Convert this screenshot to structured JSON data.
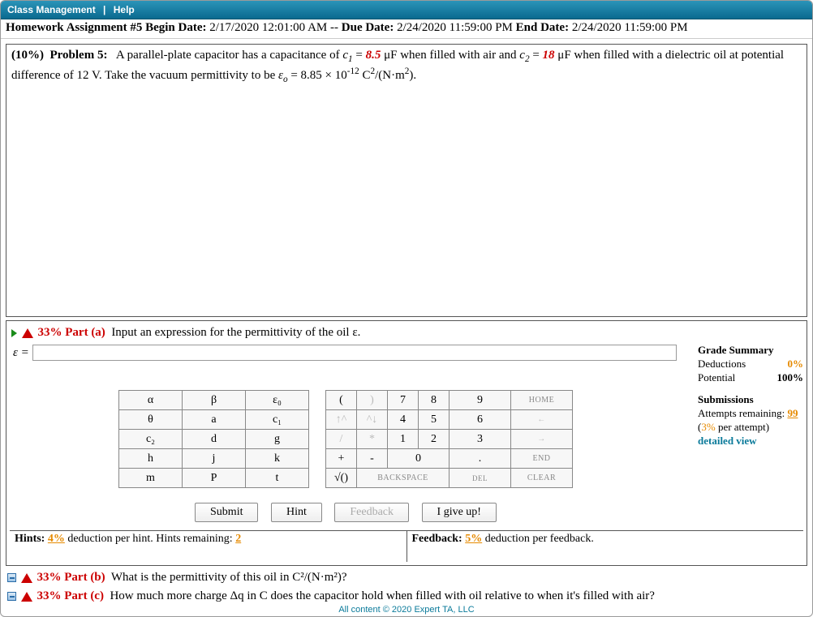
{
  "topbar": {
    "class_mgmt": "Class Management",
    "sep": "|",
    "help": "Help"
  },
  "assignment": {
    "title": "Homework Assignment #5",
    "begin_label": "Begin Date:",
    "begin": "2/17/2020 12:01:00 AM",
    "dash": "--",
    "due_label": "Due Date:",
    "due": "2/24/2020 11:59:00 PM",
    "end_label": "End Date:",
    "end": "2/24/2020 11:59:00 PM"
  },
  "problem": {
    "weight": "(10%)",
    "label": "Problem 5:",
    "t1": "A parallel-plate capacitor has a capacitance of ",
    "c1_sym": "c",
    "c1_sub": "1",
    "eq": " = ",
    "c1_val": "8.5",
    "c1_unit": " μF when filled with air and ",
    "c2_sym": "c",
    "c2_sub": "2",
    "c2_val": "18",
    "c2_unit": " μF when filled with a dielectric oil at potential difference of 12 V. Take the vacuum permittivity to be ",
    "eps": "ε",
    "eps_sub": "o",
    "eps_val": " = 8.85 × 10",
    "eps_exp": "-12",
    "eps_unit_a": " C",
    "eps_unit_b": "/(N·m",
    "eps_unit_c": ")."
  },
  "part_a": {
    "pct": "33%",
    "label": "Part (a)",
    "prompt": "Input an expression for the permittivity of the oil ε.",
    "lhs": "ε ="
  },
  "grade": {
    "hdr": "Grade Summary",
    "ded_label": "Deductions",
    "ded": "0%",
    "pot_label": "Potential",
    "pot": "100%",
    "sub_hdr": "Submissions",
    "att_label": "Attempts remaining:",
    "att": "99",
    "per": "(3% per attempt)",
    "detail": "detailed view"
  },
  "vars": [
    [
      "α",
      "β",
      "ε₀"
    ],
    [
      "θ",
      "a",
      "c₁"
    ],
    [
      "c₂",
      "d",
      "g"
    ],
    [
      "h",
      "j",
      "k"
    ],
    [
      "m",
      "P",
      "t"
    ]
  ],
  "nums": {
    "r1": [
      "(",
      ")",
      "7",
      "8",
      "9",
      "HOME"
    ],
    "r2": [
      "↑^",
      "^↓",
      "4",
      "5",
      "6",
      "←"
    ],
    "r3": [
      "/",
      "*",
      "1",
      "2",
      "3",
      "→"
    ],
    "r4": [
      "+",
      "-",
      "0",
      ".",
      "END"
    ],
    "r5": [
      "√()",
      "BACKSPACE",
      "DEL",
      "CLEAR"
    ]
  },
  "actions": {
    "submit": "Submit",
    "hint": "Hint",
    "feedback": "Feedback",
    "giveup": "I give up!"
  },
  "hints": {
    "h_label": "Hints:",
    "h_pct": "4%",
    "h_txt1": " deduction per hint. Hints remaining: ",
    "h_rem": "2",
    "f_label": "Feedback:",
    "f_pct": "5%",
    "f_txt": " deduction per feedback."
  },
  "part_b": {
    "pct": "33%",
    "label": "Part (b)",
    "txt": "What is the permittivity of this oil in C²/(N·m²)?"
  },
  "part_c": {
    "pct": "33%",
    "label": "Part (c)",
    "txt": "How much more charge Δq in C does the capacitor hold when filled with oil relative to when it's filled with air?"
  },
  "footer": "All content © 2020 Expert TA, LLC"
}
